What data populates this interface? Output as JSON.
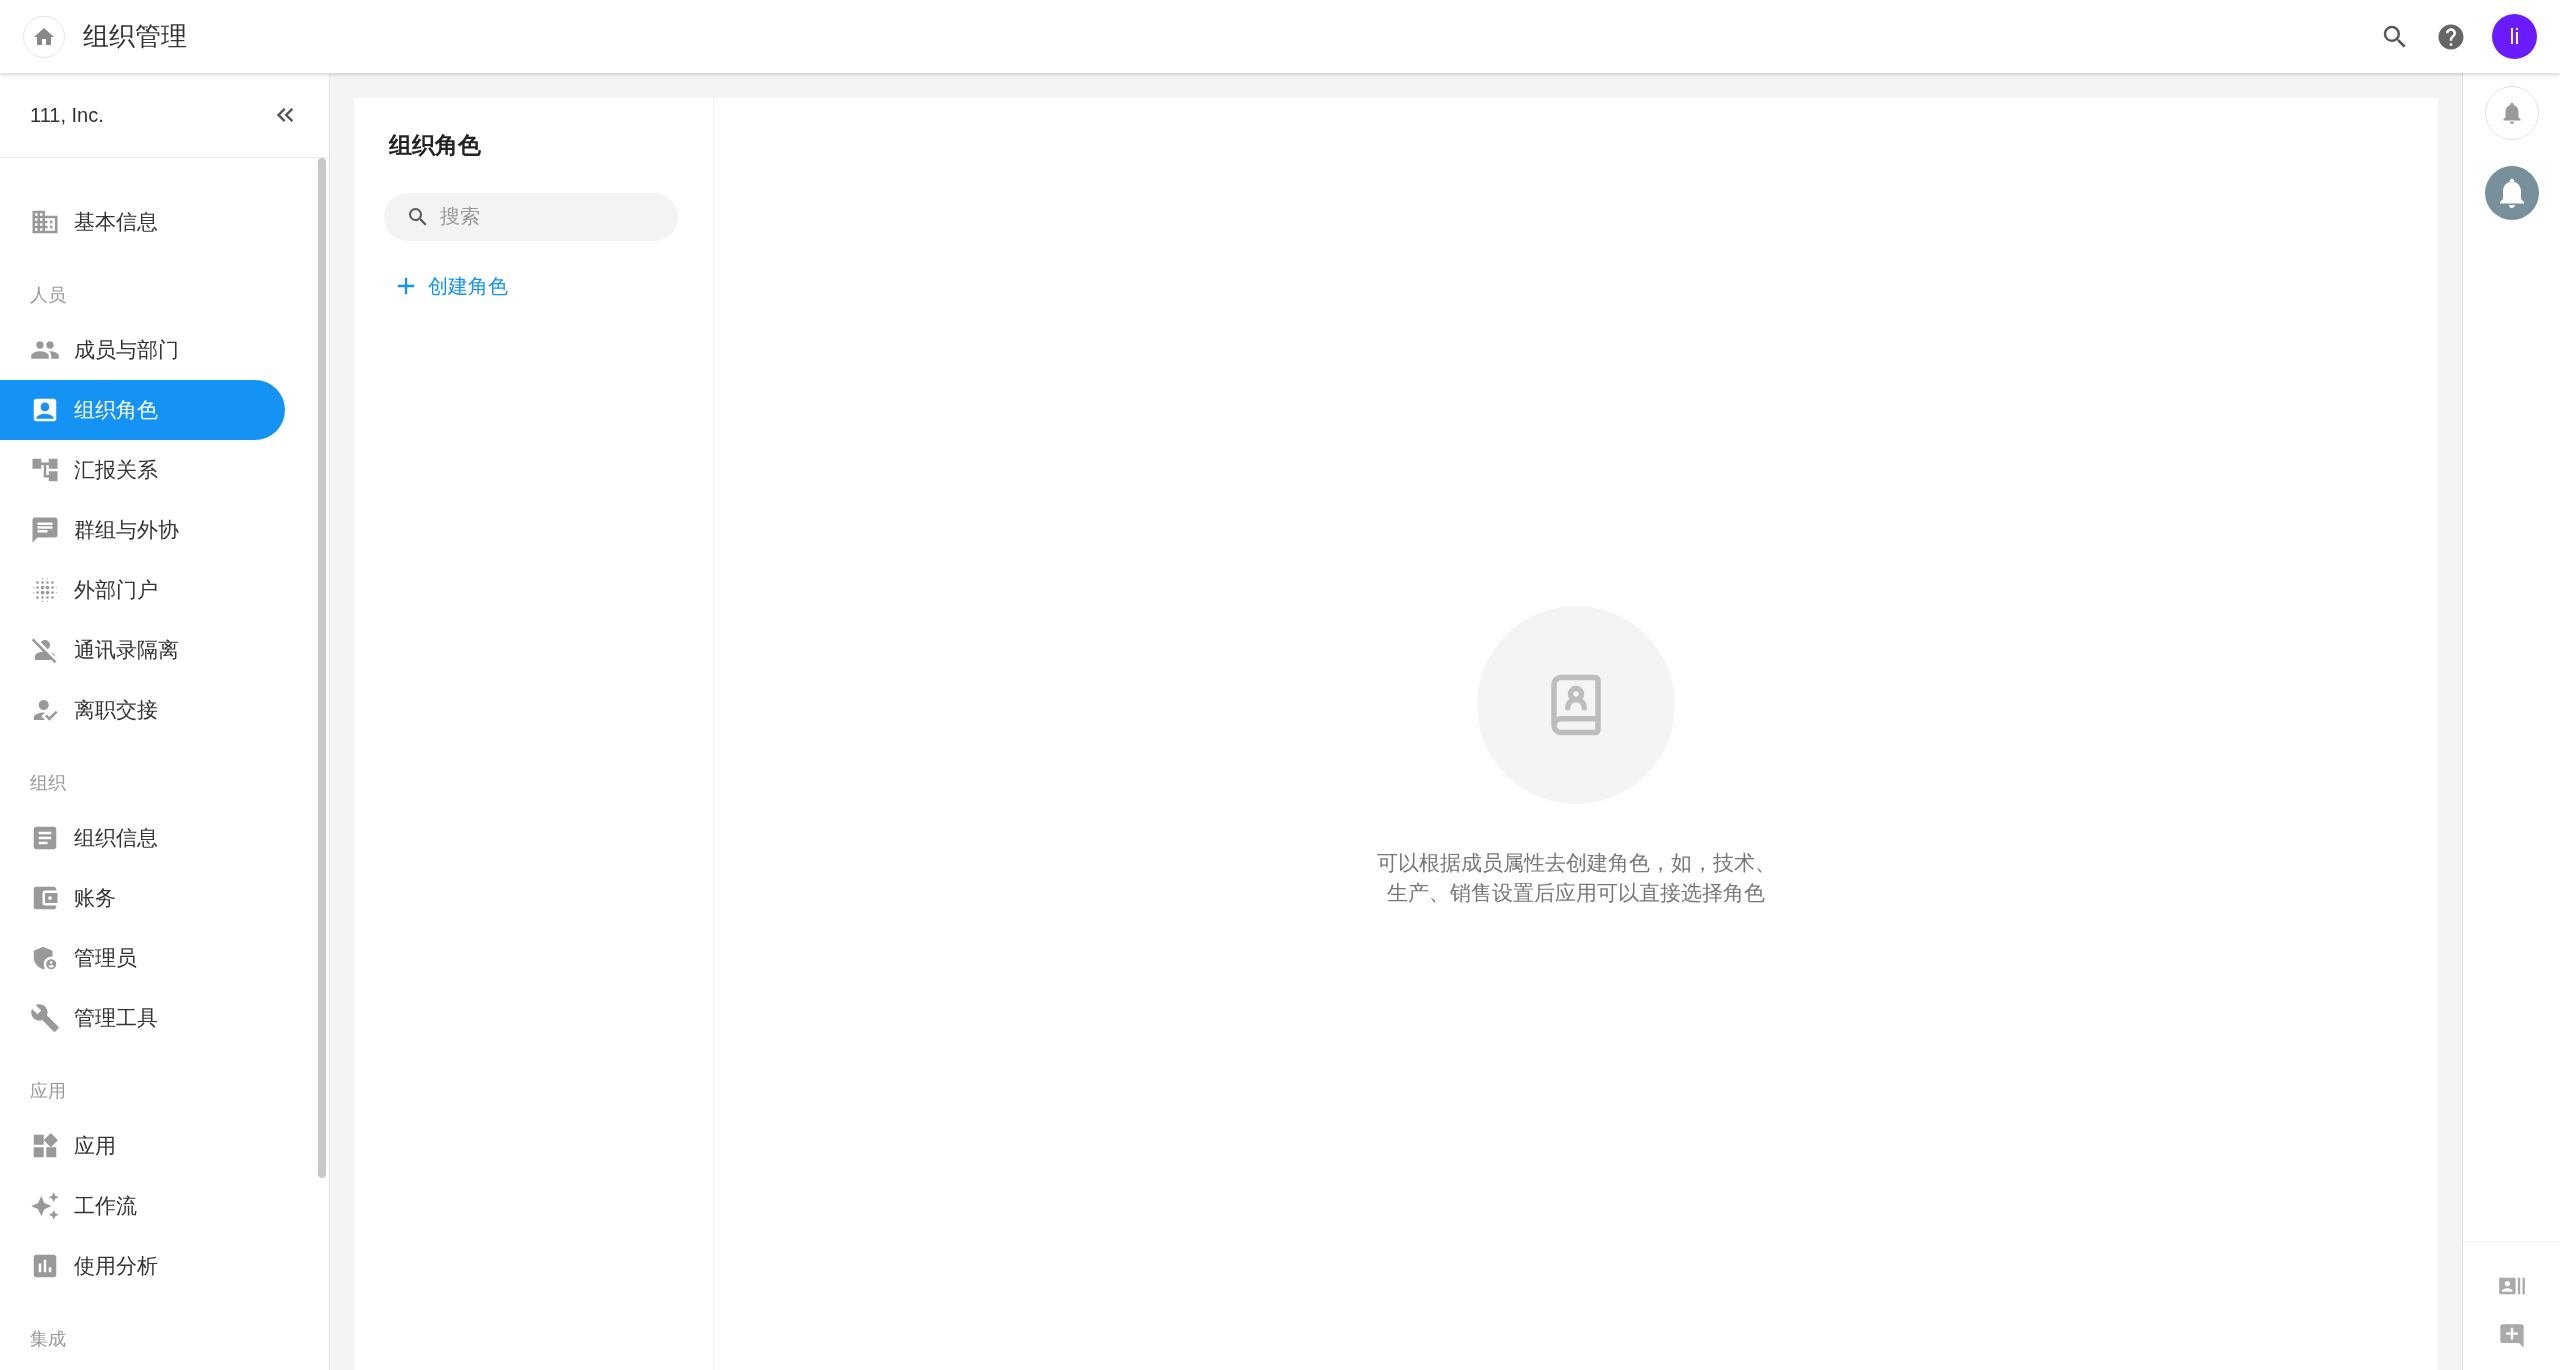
{
  "header": {
    "title": "组织管理",
    "avatar": "li"
  },
  "sidebar": {
    "org_name": "111, Inc.",
    "sections": [
      {
        "items": [
          {
            "label": "基本信息",
            "selected": false
          }
        ]
      },
      {
        "heading": "人员",
        "items": [
          {
            "label": "成员与部门",
            "selected": false
          },
          {
            "label": "组织角色",
            "selected": true
          },
          {
            "label": "汇报关系",
            "selected": false
          },
          {
            "label": "群组与外协",
            "selected": false
          },
          {
            "label": "外部门户",
            "selected": false
          },
          {
            "label": "通讯录隔离",
            "selected": false
          },
          {
            "label": "离职交接",
            "selected": false
          }
        ]
      },
      {
        "heading": "组织",
        "items": [
          {
            "label": "组织信息",
            "selected": false
          },
          {
            "label": "账务",
            "selected": false
          },
          {
            "label": "管理员",
            "selected": false
          },
          {
            "label": "管理工具",
            "selected": false
          }
        ]
      },
      {
        "heading": "应用",
        "items": [
          {
            "label": "应用",
            "selected": false
          },
          {
            "label": "工作流",
            "selected": false
          },
          {
            "label": "使用分析",
            "selected": false
          }
        ]
      },
      {
        "heading": "集成"
      }
    ]
  },
  "roles": {
    "title": "组织角色",
    "search": {
      "placeholder": "搜索"
    },
    "create_label": "创建角色"
  },
  "empty_state": {
    "message": "可以根据成员属性去创建角色，如，技术、生产、销售设置后应用可以直接选择角色"
  }
}
